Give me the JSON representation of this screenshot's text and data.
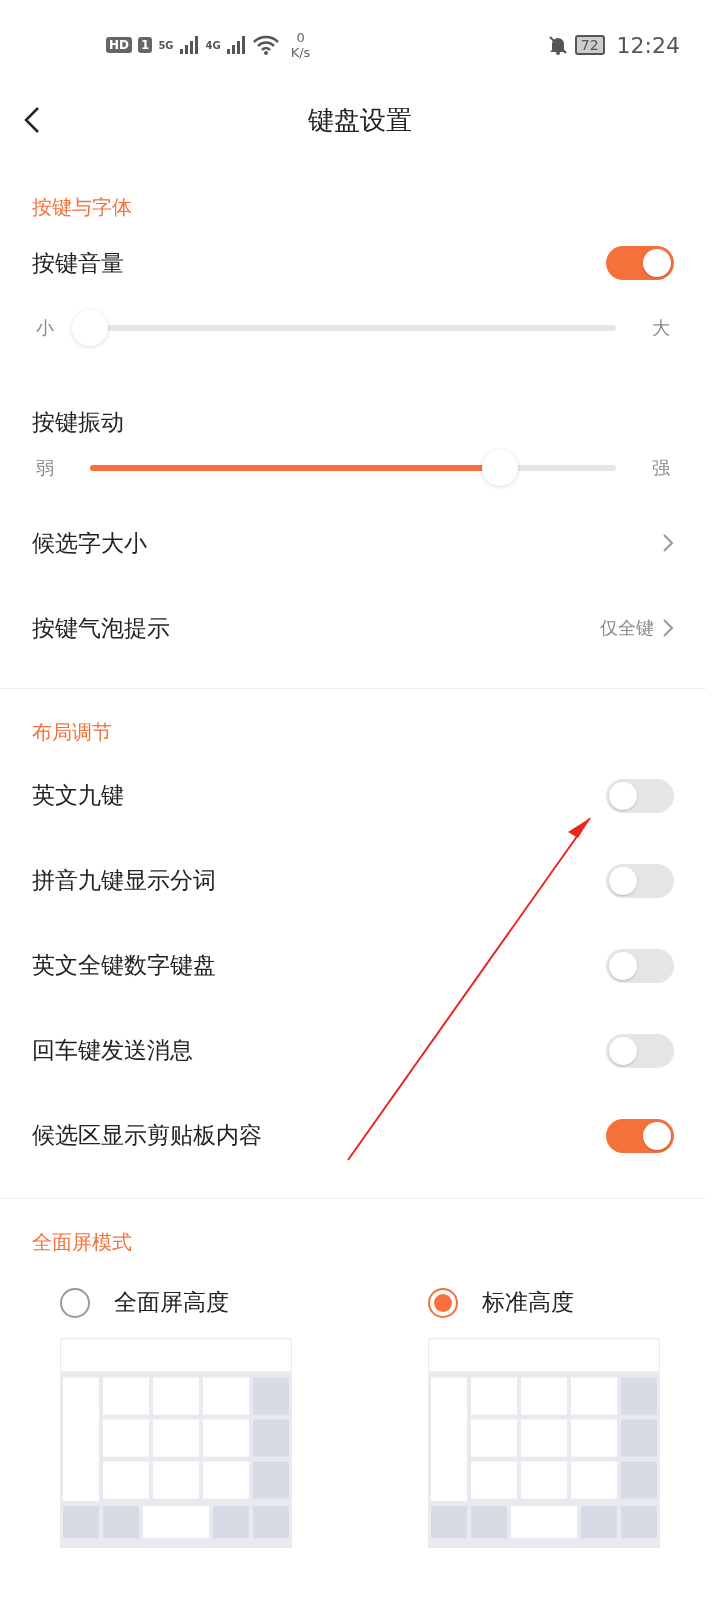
{
  "status_bar": {
    "hd": "HD",
    "sim": "1",
    "net1": "5G",
    "net2": "4G",
    "speed_value": "0",
    "speed_unit": "K/s",
    "battery": "72",
    "time": "12:24"
  },
  "header": {
    "title": "键盘设置"
  },
  "sections": [
    {
      "title": "按键与字体",
      "items": [
        {
          "kind": "toggle",
          "label": "按键音量",
          "on": true
        },
        {
          "kind": "slider",
          "min_label": "小",
          "max_label": "大",
          "level": 0.0
        },
        {
          "kind": "heading",
          "label": "按键振动"
        },
        {
          "kind": "slider",
          "min_label": "弱",
          "max_label": "强",
          "level": 0.78
        },
        {
          "kind": "link",
          "label": "候选字大小"
        },
        {
          "kind": "link",
          "label": "按键气泡提示",
          "value": "仅全键"
        }
      ]
    },
    {
      "title": "布局调节",
      "items": [
        {
          "kind": "toggle",
          "label": "英文九键",
          "on": false
        },
        {
          "kind": "toggle",
          "label": "拼音九键显示分词",
          "on": false
        },
        {
          "kind": "toggle",
          "label": "英文全键数字键盘",
          "on": false
        },
        {
          "kind": "toggle",
          "label": "回车键发送消息",
          "on": false
        },
        {
          "kind": "toggle",
          "label": "候选区显示剪贴板内容",
          "on": true
        }
      ]
    },
    {
      "title": "全面屏模式",
      "options": [
        {
          "label": "全面屏高度",
          "selected": false
        },
        {
          "label": "标准高度",
          "selected": true
        }
      ]
    }
  ]
}
